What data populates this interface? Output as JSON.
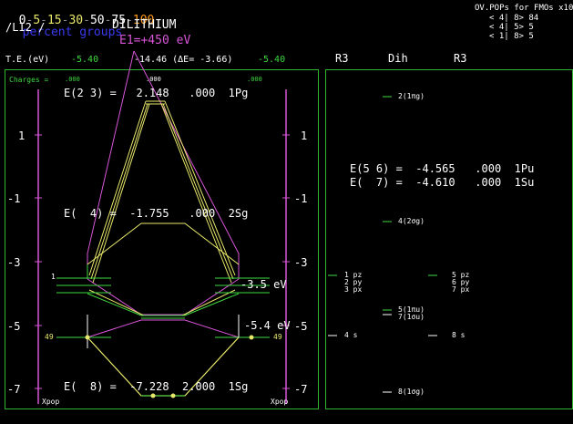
{
  "header": {
    "pct_scale": [
      "0",
      "5",
      "15",
      "30",
      "50",
      "75",
      "100"
    ],
    "pct_label": "percent groups",
    "molecule": "/LI2 /",
    "title": "DILITHIUM",
    "e1_label": "E1=+450 eV",
    "te_label": "T.E.(eV)",
    "te_left": "-5.40",
    "te_center": "-14.46 (ΔE= -3.66)",
    "te_right": "-5.40",
    "ovpop": {
      "title": "OV.POPs for FMOs x100",
      "rows": [
        "< 4| 8> 84",
        "< 4| 5> 5",
        "< 1| 8> 5"
      ]
    }
  },
  "left_panel": {
    "charges_label": "Charges =",
    "charge_left": ".000",
    "charge_center": ".000",
    "charge_right": ".000",
    "axis_ticks": [
      "1",
      "-1",
      "-3",
      "-5",
      "-7"
    ],
    "axis_ticks_right": [
      "1",
      "-1",
      "-3",
      "-5",
      "-7"
    ],
    "eq1": "E(2 3) =   2.148   .000  1Pg",
    "eq2": "E(  4) =  -1.755   .000  2Sg",
    "eq3": "E(  8) =  -7.228  2.000  1Sg",
    "side_label_top_left": "1",
    "side_label_bottom_left": "49",
    "side_label_bottom_right": "49",
    "right_energy_1": "-3.5 eV",
    "right_energy_2": "-5.4 eV",
    "xpop_left": "Xpop",
    "xpop_right": "Xpop"
  },
  "right_panel": {
    "headers": [
      "R3",
      "Dih",
      "R3"
    ],
    "eq_a": "E(5 6) =  -4.565   .000  1Pu",
    "eq_b": "E(  7) =  -4.610   .000  1Su",
    "orbitals_center": [
      "2(1πg)",
      "4(2σg)",
      "5(1πu)",
      "7(1σu)",
      "8(1σg)"
    ],
    "atom_left": [
      "1 pz",
      "2 py",
      "3 px",
      "4 s"
    ],
    "atom_right": [
      "5 pz",
      "6 py",
      "7 px",
      "8 s"
    ]
  },
  "colors": {
    "background": "#000000",
    "panel_border": "#2fb52f",
    "magenta": "#d855d8",
    "yellow": "#e8e86a",
    "green": "#3fd93f",
    "white": "#ffffff",
    "cyan": "#1ecfcf",
    "blue": "#3a3af0",
    "orange": "#ff9a1c"
  }
}
